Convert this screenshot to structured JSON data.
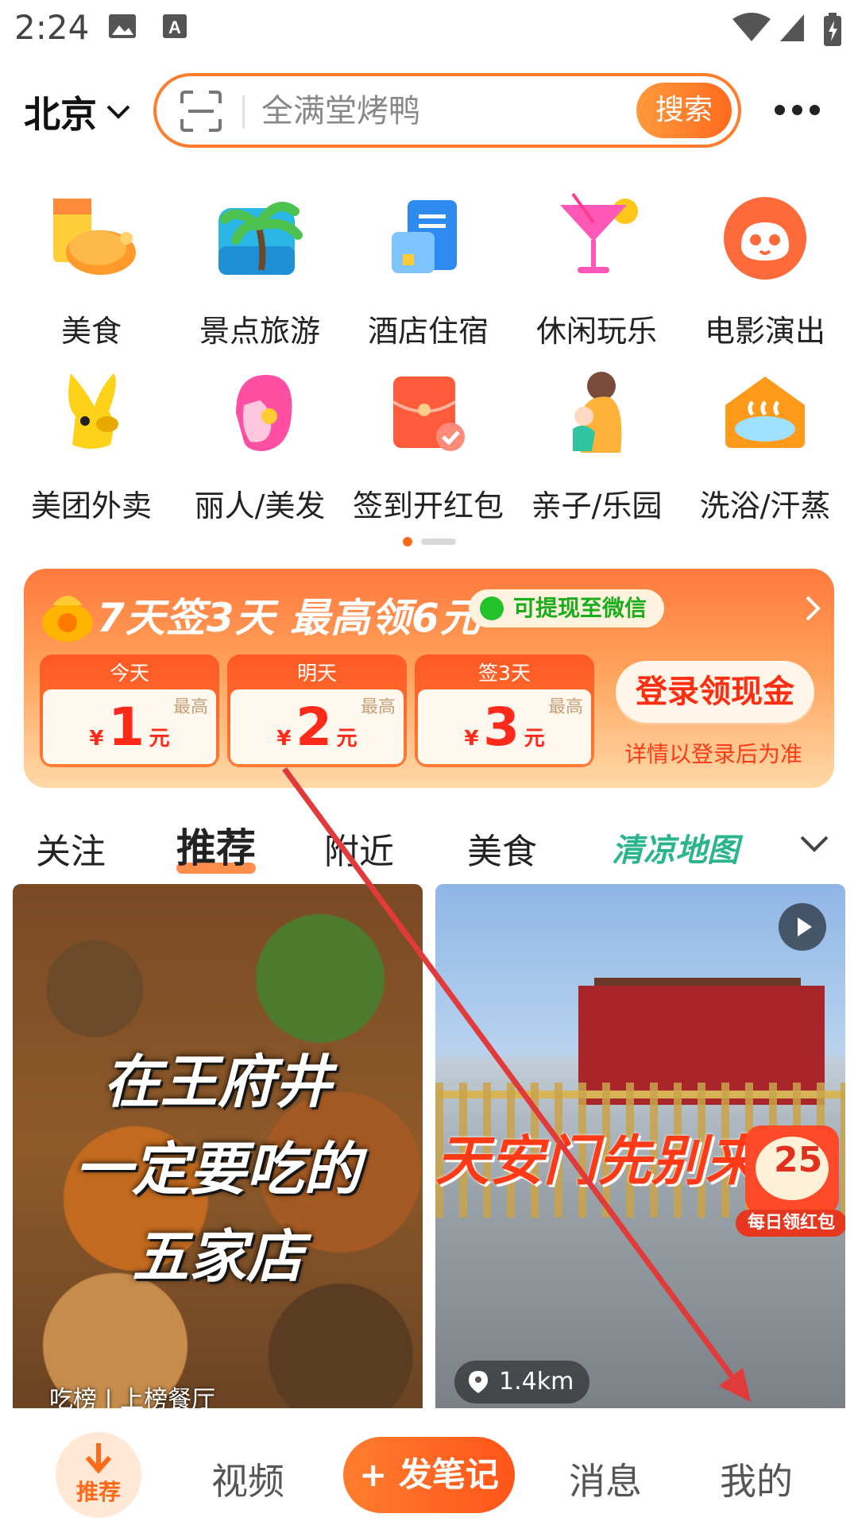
{
  "status_bar": {
    "time": "2:24"
  },
  "header": {
    "city": "北京",
    "search_placeholder": "全满堂烤鸭",
    "search_button": "搜索"
  },
  "categories": [
    {
      "label": "美食",
      "icon": "food-icon"
    },
    {
      "label": "景点旅游",
      "icon": "palm-tree-icon"
    },
    {
      "label": "酒店住宿",
      "icon": "hotel-icon"
    },
    {
      "label": "休闲玩乐",
      "icon": "cocktail-icon"
    },
    {
      "label": "电影演出",
      "icon": "cat-face-icon"
    },
    {
      "label": "美团外卖",
      "icon": "kangaroo-icon"
    },
    {
      "label": "丽人/美发",
      "icon": "beauty-icon"
    },
    {
      "label": "签到开红包",
      "icon": "red-envelope-icon"
    },
    {
      "label": "亲子/乐园",
      "icon": "parent-child-icon"
    },
    {
      "label": "洗浴/汗蒸",
      "icon": "bath-icon"
    }
  ],
  "banner": {
    "title": "7天签3天 最高领6元",
    "wechat_pill": "可提现至微信",
    "days": [
      {
        "head": "今天",
        "max": "最高",
        "yen": "¥",
        "value": "1",
        "unit": "元"
      },
      {
        "head": "明天",
        "max": "最高",
        "yen": "¥",
        "value": "2",
        "unit": "元"
      },
      {
        "head": "签3天",
        "max": "最高",
        "yen": "¥",
        "value": "3",
        "unit": "元"
      }
    ],
    "login_button": "登录领现金",
    "login_note": "详情以登录后为准"
  },
  "feed_tabs": {
    "items": [
      "关注",
      "推荐",
      "附近",
      "美食"
    ],
    "active": "推荐",
    "cool_map": "清凉地图"
  },
  "cards": [
    {
      "lines": [
        "在王府井",
        "一定要吃的",
        "五家店"
      ],
      "badge": "吃榜 | 上榜餐厅"
    },
    {
      "overlay": "天安门先别来",
      "distance": "1.4km",
      "redpack_value": "25",
      "redpack_label": "每日领红包"
    }
  ],
  "bottom_nav": {
    "home": "推荐",
    "video": "视频",
    "post": "+ 发笔记",
    "messages": "消息",
    "me": "我的"
  }
}
